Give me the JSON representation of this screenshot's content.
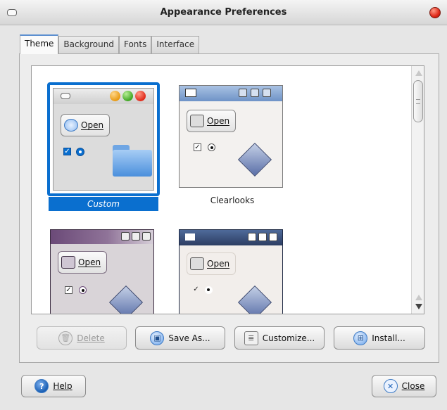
{
  "window": {
    "title": "Appearance Preferences"
  },
  "tabs": [
    {
      "label": "Theme",
      "active": true
    },
    {
      "label": "Background",
      "active": false
    },
    {
      "label": "Fonts",
      "active": false
    },
    {
      "label": "Interface",
      "active": false
    }
  ],
  "themes": [
    {
      "name": "Custom",
      "selected": true,
      "preview_button": "Open"
    },
    {
      "name": "Clearlooks",
      "selected": false,
      "preview_button": "Open"
    },
    {
      "name": "",
      "selected": false,
      "preview_button": "Open"
    },
    {
      "name": "",
      "selected": false,
      "preview_button": "Open"
    }
  ],
  "actions": {
    "delete_label": "Delete",
    "save_as_label": "Save As...",
    "customize_label": "Customize...",
    "install_label": "Install..."
  },
  "footer": {
    "help_label": "Help",
    "close_label": "Close"
  },
  "colors": {
    "selection": "#0a6fcf",
    "close_button": "#e02a1a"
  },
  "icons": [
    "window-menu-icon",
    "window-close-icon",
    "delete-icon",
    "save-icon",
    "customize-icon",
    "install-icon",
    "help-icon",
    "close-icon",
    "folder-icon"
  ]
}
